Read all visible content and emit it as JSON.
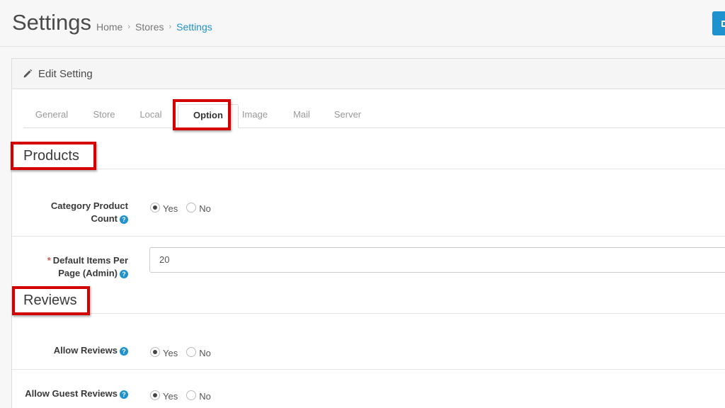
{
  "header": {
    "title": "Settings",
    "breadcrumb": [
      "Home",
      "Stores",
      "Settings"
    ],
    "breadcrumb_separator": "›"
  },
  "panel": {
    "title": "Edit Setting"
  },
  "tabs": [
    "General",
    "Store",
    "Local",
    "Option",
    "Image",
    "Mail",
    "Server"
  ],
  "active_tab": "Option",
  "sections": {
    "products": {
      "title": "Products",
      "category_product_count": {
        "label_line1": "Category Product",
        "label_line2": "Count",
        "yes": "Yes",
        "no": "No",
        "selected": "Yes"
      },
      "default_items_per_page": {
        "required": "*",
        "label_line1": "Default Items Per",
        "label_line2": "Page (Admin)",
        "value": "20"
      }
    },
    "reviews": {
      "title": "Reviews",
      "allow_reviews": {
        "label": "Allow Reviews",
        "yes": "Yes",
        "no": "No",
        "selected": "Yes"
      },
      "allow_guest_reviews": {
        "label": "Allow Guest Reviews",
        "yes": "Yes",
        "no": "No",
        "selected": "Yes"
      }
    }
  },
  "help_glyph": "?",
  "colors": {
    "accent": "#1e91cf",
    "highlight": "#d40000",
    "required": "#d9534f"
  }
}
